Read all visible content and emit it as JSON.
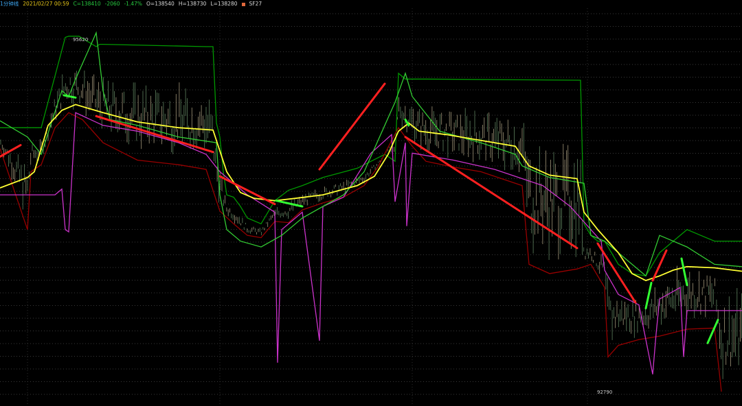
{
  "header": {
    "period_label": "1分钟线",
    "datetime": "2021/02/27 00:59",
    "close_text": "C=138410",
    "change_text": "-2060",
    "change_pct_text": "-1.47%",
    "open_text": "O=138540",
    "high_text": "H=138730",
    "low_text": "L=138280",
    "symbol": "SF27",
    "colors": {
      "period": "#3fa9f5",
      "datetime": "#e6c619",
      "close": "#27c93f",
      "change": "#27c93f",
      "ohlc": "#d9d9d9",
      "symbol_box": "#e0683c"
    }
  },
  "extremes": {
    "high_label": "95620",
    "low_label": "92790"
  },
  "chart_data": {
    "type": "line",
    "title": "",
    "xlabel": "",
    "ylabel": "",
    "ylim": [
      92500,
      95900
    ],
    "grid": true,
    "marked_high": 95620,
    "marked_low": 92790,
    "series": [
      {
        "color": "#ffff33",
        "x": [
          0,
          40,
          50,
          60,
          70,
          90,
          110,
          150,
          200,
          260,
          310,
          330,
          350,
          370,
          400,
          430,
          470,
          520,
          545,
          565,
          580,
          595,
          610,
          650,
          700,
          750,
          770,
          800,
          840,
          850,
          870,
          900,
          920,
          940,
          960,
          980,
          1000,
          1040,
          1080
        ],
        "values": [
          94360,
          94450,
          94500,
          94700,
          94900,
          95030,
          95080,
          95010,
          94930,
          94880,
          94860,
          94500,
          94320,
          94270,
          94250,
          94270,
          94300,
          94380,
          94460,
          94650,
          94850,
          94920,
          94850,
          94820,
          94770,
          94720,
          94550,
          94470,
          94440,
          94150,
          94000,
          93800,
          93620,
          93560,
          93600,
          93650,
          93680,
          93670,
          93640
        ]
      },
      {
        "color": "#33cc33",
        "x": [
          0,
          40,
          60,
          90,
          100,
          110,
          140,
          150,
          160,
          200,
          260,
          315,
          320,
          330,
          350,
          380,
          410,
          440,
          470,
          500,
          530,
          560,
          575,
          590,
          600,
          640,
          700,
          750,
          760,
          800,
          850,
          860,
          880,
          900,
          920,
          940,
          960,
          1000,
          1040,
          1080
        ],
        "values": [
          94940,
          94800,
          94650,
          95200,
          95150,
          95300,
          95700,
          95200,
          94950,
          94900,
          94800,
          94750,
          94300,
          94000,
          93900,
          93850,
          93950,
          94100,
          94200,
          94300,
          94500,
          94900,
          95100,
          95350,
          95150,
          94850,
          94750,
          94650,
          94550,
          94450,
          94400,
          93950,
          93900,
          93800,
          93700,
          93600,
          93950,
          93850,
          93700,
          93680
        ]
      },
      {
        "color": "#cc33cc",
        "x": [
          0,
          80,
          90,
          95,
          100,
          105,
          110,
          150,
          200,
          260,
          300,
          320,
          360,
          400,
          404,
          410,
          440,
          465,
          470,
          500,
          540,
          570,
          575,
          590,
          592,
          600,
          660,
          720,
          760,
          790,
          830,
          860,
          875,
          880,
          900,
          930,
          950,
          955,
          960,
          990,
          995,
          1000,
          1040,
          1080
        ],
        "values": [
          94300,
          94300,
          94350,
          94000,
          93980,
          94500,
          95010,
          94900,
          94850,
          94750,
          94650,
          94500,
          94300,
          94150,
          92850,
          94000,
          94150,
          93040,
          94200,
          94280,
          94660,
          94820,
          94240,
          94750,
          94030,
          94660,
          94600,
          94520,
          94440,
          94380,
          94200,
          94000,
          93900,
          93650,
          93440,
          93350,
          92750,
          93100,
          93400,
          93500,
          92900,
          93300,
          93300,
          93300
        ]
      },
      {
        "color": "#990000",
        "x": [
          0,
          40,
          45,
          60,
          80,
          100,
          120,
          150,
          200,
          260,
          300,
          320,
          340,
          360,
          380,
          400,
          420,
          440,
          470,
          500,
          530,
          550,
          570,
          580,
          600,
          620,
          660,
          700,
          740,
          760,
          770,
          800,
          840,
          860,
          880,
          885,
          900,
          930,
          960,
          1000,
          1040,
          1050
        ],
        "values": [
          94700,
          94000,
          94500,
          94560,
          94880,
          95010,
          94950,
          94750,
          94600,
          94560,
          94520,
          94160,
          94050,
          93950,
          93930,
          94070,
          94060,
          94170,
          94230,
          94280,
          94380,
          94540,
          94770,
          94880,
          94720,
          94590,
          94540,
          94500,
          94420,
          94380,
          93700,
          93620,
          93660,
          93700,
          93500,
          92900,
          93000,
          93050,
          93080,
          93140,
          93150,
          92600
        ]
      },
      {
        "color": "#009900",
        "x": [
          0,
          60,
          95,
          100,
          115,
          140,
          145,
          150,
          300,
          310,
          315,
          320,
          325,
          330,
          340,
          350,
          360,
          380,
          400,
          420,
          440,
          470,
          520,
          560,
          575,
          580,
          590,
          600,
          610,
          620,
          845,
          850,
          860,
          870,
          880,
          890,
          900,
          920,
          940,
          960,
          980,
          1000,
          1040,
          1080
        ],
        "values": [
          94880,
          94880,
          95660,
          95670,
          95670,
          95580,
          95600,
          95600,
          95580,
          95580,
          94920,
          94800,
          94500,
          94300,
          94280,
          94200,
          94100,
          94050,
          94250,
          94340,
          94380,
          94450,
          94530,
          94650,
          94590,
          95350,
          95300,
          95300,
          95300,
          95300,
          95290,
          94050,
          93950,
          93900,
          93900,
          93800,
          93700,
          93620,
          93600,
          93800,
          93900,
          94000,
          93900,
          93900
        ]
      },
      {
        "color": "#ff2020",
        "segments": [
          {
            "x": [
              0,
              30
            ],
            "values": [
              94630,
              94730
            ]
          },
          {
            "x": [
              140,
              310
            ],
            "values": [
              94980,
              94670
            ]
          },
          {
            "x": [
              320,
              400
            ],
            "values": [
              94460,
              94220
            ]
          },
          {
            "x": [
              465,
              560
            ],
            "values": [
              94520,
              95260
            ]
          },
          {
            "x": [
              590,
              840
            ],
            "values": [
              94800,
              93840
            ]
          },
          {
            "x": [
              870,
              925
            ],
            "values": [
              93880,
              93370
            ]
          },
          {
            "x": [
              950,
              970
            ],
            "values": [
              93560,
              93820
            ]
          }
        ]
      },
      {
        "color": "#33ff33",
        "segments": [
          {
            "x": [
              93,
              110
            ],
            "values": [
              95160,
              95140
            ]
          },
          {
            "x": [
              402,
              440
            ],
            "values": [
              94250,
              94200
            ]
          },
          {
            "x": [
              590,
              595
            ],
            "values": [
              94950,
              94900
            ]
          },
          {
            "x": [
              940,
              948
            ],
            "values": [
              93320,
              93540
            ]
          },
          {
            "x": [
              992,
              1000
            ],
            "values": [
              93750,
              93520
            ]
          },
          {
            "x": [
              1030,
              1045
            ],
            "values": [
              93020,
              93220
            ]
          }
        ]
      }
    ]
  }
}
